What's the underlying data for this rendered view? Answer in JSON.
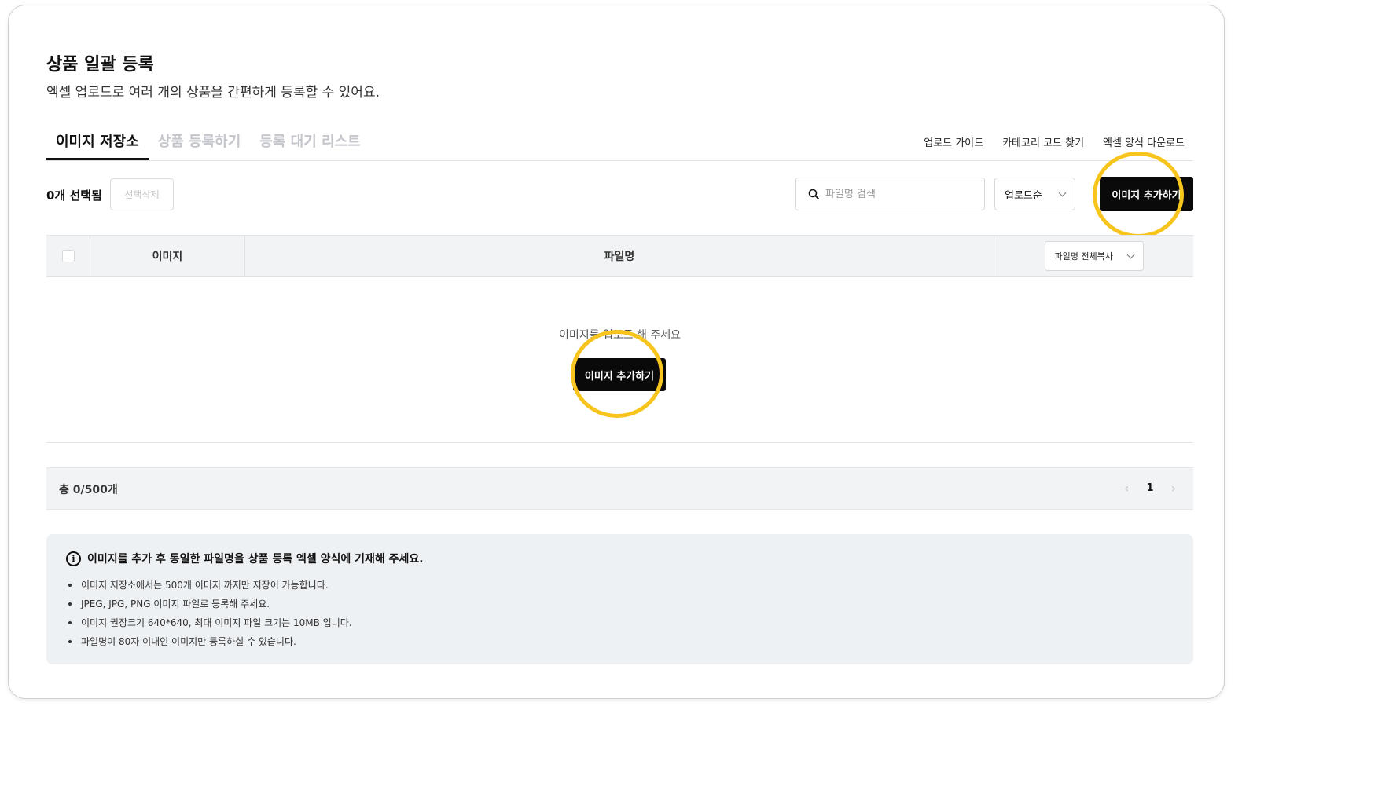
{
  "page": {
    "title": "상품 일괄 등록",
    "subtitle": "엑셀 업로드로 여러 개의 상품을 간편하게 등록할 수 있어요."
  },
  "tabs": [
    {
      "label": "이미지 저장소",
      "active": true
    },
    {
      "label": "상품 등록하기",
      "active": false
    },
    {
      "label": "등록 대기 리스트",
      "active": false
    }
  ],
  "top_links": [
    "업로드 가이드",
    "카테코리 코드 찾기",
    "엑셀 양식 다운로드"
  ],
  "toolbar": {
    "selected_count": "0개 선택됨",
    "delete_selected": "선택삭제",
    "search_placeholder": "파일명 검색",
    "sort_value": "업로드순",
    "add_image": "이미지 추가하기"
  },
  "table": {
    "columns": [
      "이미지",
      "파일명"
    ],
    "copy_all": "파일명 전체복사",
    "empty_message": "이미지를 업로드 해 주세요",
    "empty_add_button": "이미지 추가하기"
  },
  "footer": {
    "total": "총 0/500개",
    "current_page": "1"
  },
  "notice": {
    "heading": "이미지를 추가 후 동일한 파일명을 상품 등록 엑셀 양식에 기재해 주세요.",
    "items": [
      "이미지 저장소에서는 500개 이미지 까지만 저장이 가능합니다.",
      "JPEG, JPG, PNG 이미지 파일로 등록해 주세요.",
      "이미지 권장크기 640*640, 최대 이미지 파일 크기는 10MB 입니다.",
      "파일명이 80자 이내인 이미지만 등록하실 수 있습니다."
    ]
  },
  "colors": {
    "highlight": "#f7c51e",
    "primary_button": "#0a0a0a",
    "table_header_bg": "#f1f3f5"
  }
}
